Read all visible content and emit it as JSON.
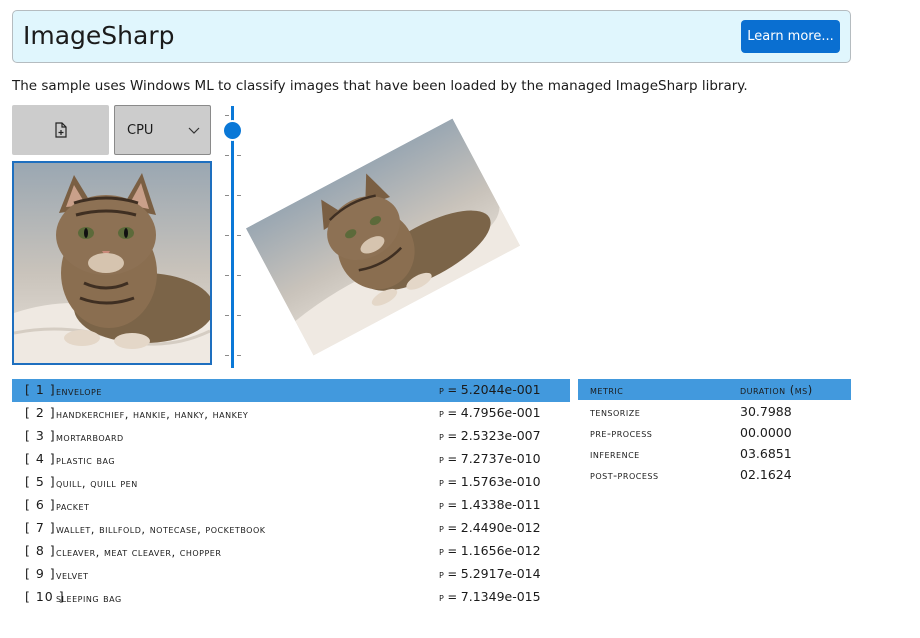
{
  "header": {
    "title": "ImageSharp",
    "learn_more": "Learn more..."
  },
  "description": "The sample uses Windows ML to classify images that have been loaded by the managed ImageSharp library.",
  "toolbar": {
    "file_icon": "open-file-icon",
    "device": "CPU",
    "device_icon": "chevron-down-icon"
  },
  "slider": {
    "value_fraction": 0.0
  },
  "images": {
    "original": "tabby-cat-photo",
    "rotated": "tabby-cat-photo-rotated"
  },
  "results": [
    {
      "rank": "[ 1 ]",
      "label": "envelope",
      "prob": "5.2044e-001",
      "selected": true
    },
    {
      "rank": "[ 2 ]",
      "label": "handkerchief, hankie, hanky, hankey",
      "prob": "4.7956e-001"
    },
    {
      "rank": "[ 3 ]",
      "label": "mortarboard",
      "prob": "2.5323e-007"
    },
    {
      "rank": "[ 4 ]",
      "label": "plastic bag",
      "prob": "7.2737e-010"
    },
    {
      "rank": "[ 5 ]",
      "label": "quill, quill pen",
      "prob": "1.5763e-010"
    },
    {
      "rank": "[ 6 ]",
      "label": "packet",
      "prob": "1.4338e-011"
    },
    {
      "rank": "[ 7 ]",
      "label": "wallet, billfold, notecase, pocketbook",
      "prob": "2.4490e-012"
    },
    {
      "rank": "[ 8 ]",
      "label": "cleaver, meat cleaver, chopper",
      "prob": "1.1656e-012"
    },
    {
      "rank": "[ 9 ]",
      "label": "velvet",
      "prob": "5.2917e-014"
    },
    {
      "rank": "[ 10 ]",
      "label": "sleeping bag",
      "prob": "7.1349e-015"
    }
  ],
  "prob_prefix": "p = ",
  "metrics": {
    "header": {
      "metric": "metric",
      "duration": "duration (ms)"
    },
    "rows": [
      {
        "metric": "tensorize",
        "duration": "30.7988"
      },
      {
        "metric": "pre-process",
        "duration": "00.0000"
      },
      {
        "metric": "inference",
        "duration": "03.6851"
      },
      {
        "metric": "post-process",
        "duration": "02.1624"
      }
    ]
  },
  "colors": {
    "accent": "#0a78d7",
    "selection": "#4299dd",
    "header_bg": "#e0f6fd"
  }
}
